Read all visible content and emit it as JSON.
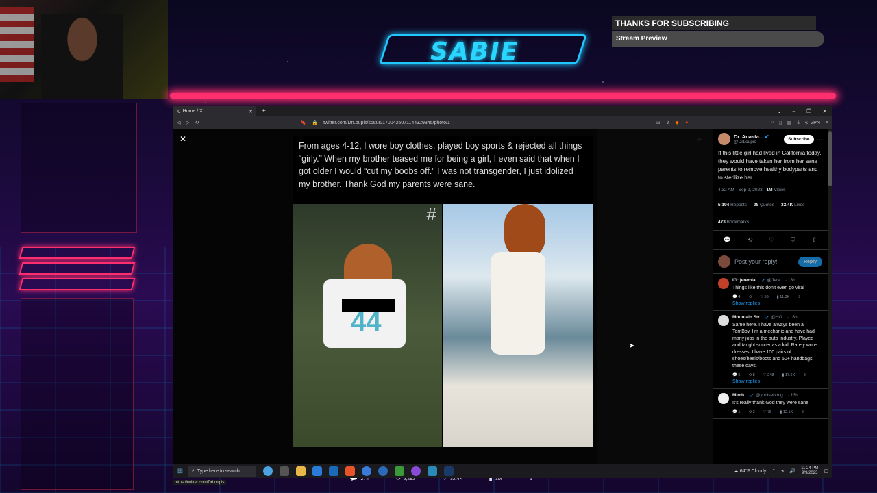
{
  "stream": {
    "logo_text": "SABIE",
    "banner_title": "THANKS FOR SUBSCRIBING",
    "banner_subtitle": "Stream Preview"
  },
  "browser": {
    "tab_title": "Home / X",
    "url": "twitter.com/DrLoupis/status/1700426071144329345/photo/1",
    "vpn_label": "VPN",
    "status_url": "https://twitter.com/DrLoupis"
  },
  "viewer": {
    "caption": "From ages 4-12, I wore boy clothes, played boy sports & rejected all things “girly.” When my brother teased me for being a girl, I even said that when I got older I would “cut my boobs off.” I was not transgender, I just idolized my brother. Thank God my parents were sane.",
    "jersey_number": "44",
    "watermark": "#",
    "actions": {
      "replies": "274",
      "reposts": "5,292",
      "likes": "32.4K",
      "views": "1M"
    }
  },
  "tweet": {
    "author_name": "Dr. Anasta...",
    "author_handle": "@DrLoupis",
    "subscribe_label": "Subscribe",
    "text": "If this little girl had lived in California today, they would have taken her from her sane parents to remove healthy bodyparts and to sterilize her.",
    "time": "4:32 AM · Sep 9, 2023 ·",
    "views_count": "1M",
    "views_label": "Views",
    "reposts_count": "5,194",
    "reposts_label": "Reposts",
    "quotes_count": "98",
    "quotes_label": "Quotes",
    "likes_count": "32.4K",
    "likes_label": "Likes",
    "bookmarks_count": "473",
    "bookmarks_label": "Bookmarks",
    "reply_placeholder": "Post your reply!",
    "reply_button": "Reply"
  },
  "replies": [
    {
      "name": "IG: jeremia...",
      "handle": "@Jere... · 18h",
      "text": "Things like this don't even go viral",
      "counts": [
        "4",
        "",
        "56",
        "11.3K"
      ],
      "show_replies": "Show replies"
    },
    {
      "name": "Mountain Str...",
      "handle": "@HO... · 18h",
      "text": "Same here. I have always been a TomBoy. I'm a mechanic and have had many jobs in the auto Industry. Played and taught soccer as a kid. Rarely wore dresses. I have 100 pairs of shoes/heels/boots and 50+ handbags these days.",
      "counts": [
        "6",
        "8",
        "248",
        "17.6K"
      ],
      "show_replies": "Show replies"
    },
    {
      "name": "Mimb...",
      "handle": "@yunisehbrig... · 13h",
      "text": "It's really thank God they were sane",
      "counts": [
        "1",
        "3",
        "75",
        "12.1K"
      ],
      "show_replies": ""
    }
  ],
  "taskbar": {
    "search_placeholder": "Type here to search",
    "weather": "64°F  Cloudy",
    "time": "11:24 PM",
    "date": "9/9/2023"
  },
  "colors": {
    "neon_pink": "#ff2e6e",
    "neon_cyan": "#20c8ff",
    "twitter_blue": "#1d9bf0"
  }
}
